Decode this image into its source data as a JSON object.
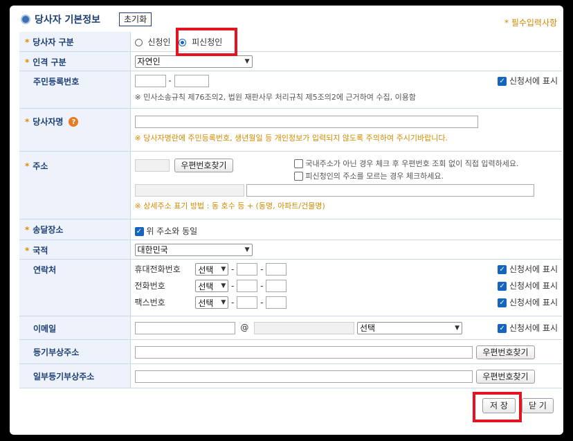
{
  "header": {
    "title": "당사자 기본정보",
    "reset_label": "초기화",
    "required_note": "* 필수입력사항"
  },
  "party_type": {
    "label": "당사자 구분",
    "options": [
      "신청인",
      "피신청인"
    ],
    "selected": "피신청인"
  },
  "person_type": {
    "label": "인격 구분",
    "value": "자연인"
  },
  "rrn": {
    "label": "주민등록번호",
    "dash": "-",
    "show_label": "신청서에 표시",
    "note": "※ 민사소송규칙 제76조의2, 법원 재판사무 처리규칙 제5조의2에 근거하여 수집, 이용함"
  },
  "party_name": {
    "label": "당사자명",
    "help_icon": "question-icon",
    "note": "※ 당사자명란에 주민등록번호, 생년월일 등 개인정보가 입력되지 않도록 주의하여 주시기바랍니다."
  },
  "address": {
    "label": "주소",
    "zip_button": "우편번호찾기",
    "check1": "국내주소가 아닌 경우 체크 후 우편번호 조회 없이 직접 입력하세요.",
    "check2": "피신청인의 주소를 모르는 경우 체크하세요.",
    "note": "※ 상세주소 표기 방법 : 동 호수 등 + (동명, 아파트/건물명)"
  },
  "delivery": {
    "label": "송달장소",
    "same_label": "위 주소와 동일"
  },
  "nationality": {
    "label": "국적",
    "value": "대한민국"
  },
  "contact": {
    "label": "연락처",
    "rows": [
      {
        "label": "휴대전화번호",
        "select": "선택",
        "show_label": "신청서에 표시"
      },
      {
        "label": "전화번호",
        "select": "선택",
        "show_label": "신청서에 표시"
      },
      {
        "label": "팩스번호",
        "select": "선택",
        "show_label": "신청서에 표시"
      }
    ],
    "dash": "-"
  },
  "email": {
    "label": "이메일",
    "at": "@",
    "select": "선택",
    "show_label": "신청서에 표시"
  },
  "reg_address": {
    "label": "등기부상주소",
    "zip_button": "우편번호찾기"
  },
  "partial_reg_address": {
    "label": "일부등기부상주소",
    "zip_button": "우편번호찾기"
  },
  "footer": {
    "save_label": "저 장",
    "close_label": "닫 기"
  },
  "colors": {
    "highlight": "#e3141f",
    "accent": "#1565c0",
    "required": "#e08a00",
    "label_bg": "#eef3fb"
  }
}
